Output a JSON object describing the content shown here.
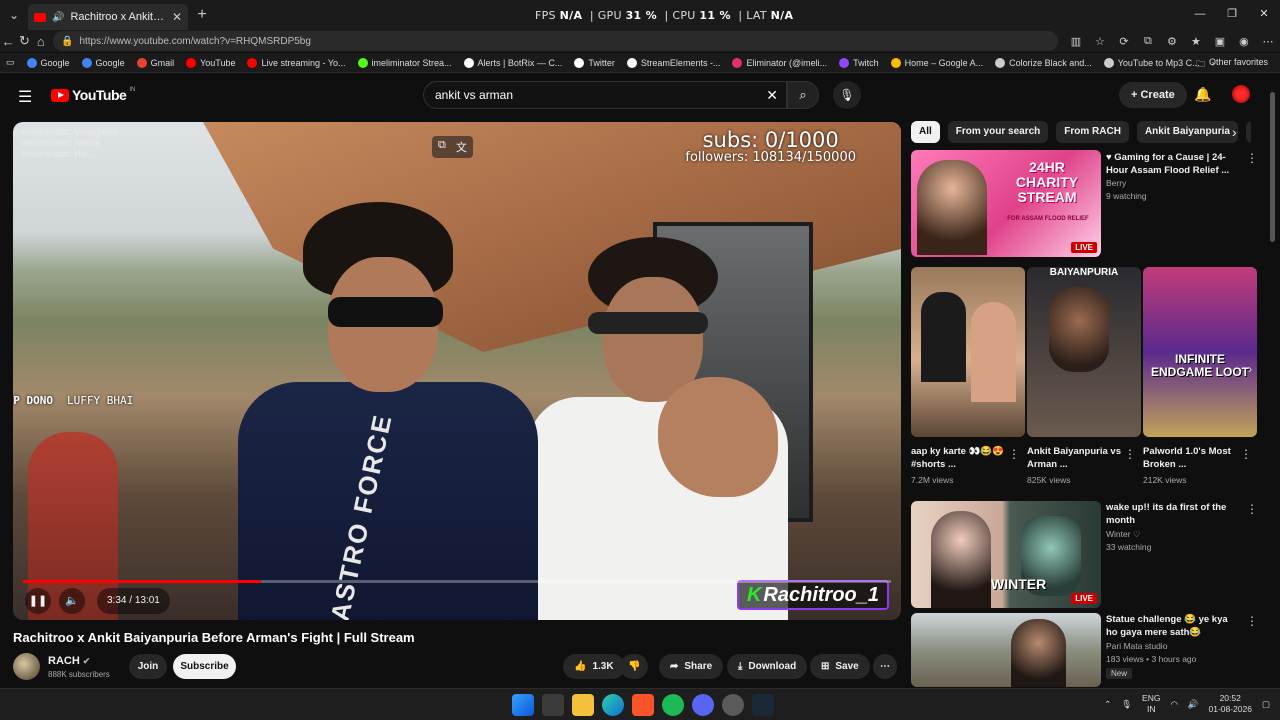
{
  "browser": {
    "tab_title": "Rachitroo x Ankit Baiyanpuria",
    "perf_overlay": {
      "fps_label": "FPS",
      "fps": "N/A",
      "gpu_label": "GPU",
      "gpu": "31 %",
      "cpu_label": "CPU",
      "cpu": "11 %",
      "lat_label": "LAT",
      "lat": "N/A"
    },
    "url": "https://www.youtube.com/watch?v=RHQMSRDP5bg",
    "bookmarks": [
      {
        "label": "Google",
        "color": "#4285f4"
      },
      {
        "label": "Google",
        "color": "#4285f4"
      },
      {
        "label": "Gmail",
        "color": "#ea4335"
      },
      {
        "label": "YouTube",
        "color": "#ff0000"
      },
      {
        "label": "Live streaming - Yo...",
        "color": "#ff0000"
      },
      {
        "label": "imeliminator Strea...",
        "color": "#53fc18"
      },
      {
        "label": "Alerts | BotRix — C...",
        "color": "#ffffff"
      },
      {
        "label": "Twitter",
        "color": "#ffffff"
      },
      {
        "label": "StreamElements -...",
        "color": "#ffffff"
      },
      {
        "label": "Eliminator (@imeli...",
        "color": "#e1306c"
      },
      {
        "label": "Twitch",
        "color": "#9146ff"
      },
      {
        "label": "Home – Google A...",
        "color": "#fbbc04"
      },
      {
        "label": "Colorize Black and...",
        "color": "#cccccc"
      },
      {
        "label": "YouTube to Mp3 C...",
        "color": "#cccccc"
      }
    ],
    "other_favorites": "Other favorites"
  },
  "youtube": {
    "logo_text": "YouTube",
    "logo_region": "IN",
    "search_query": "ankit vs arman",
    "create_label": "Create"
  },
  "video": {
    "stream_overlay": {
      "subs": "subs: 0/1000",
      "followers": "followers: 108134/150000",
      "top_dono": "TOP DONO",
      "top_dono_name": "LUFFY BHAI",
      "ghost_chat": "imeliminator: Vonsgreen\nimeliminator: Nessa\nimeliminator: Hai..."
    },
    "shirt_text": "ASTRO FORCE",
    "watermark": "Rachitroo_1",
    "watermark_k": "K",
    "time_current": "3:34",
    "time_total": "13:01",
    "time_sep": " / ",
    "progress": 0.274,
    "title": "Rachitroo x Ankit Baiyanpuria Before Arman's Fight | Full Stream",
    "channel": {
      "name": "RACH",
      "subscribers": "888K subscribers",
      "join": "Join",
      "subscribe": "Subscribe"
    },
    "actions": {
      "likes": "1.3K",
      "share": "Share",
      "download": "Download",
      "save": "Save"
    }
  },
  "sidebar": {
    "chips": [
      "All",
      "From your search",
      "From RACH",
      "Ankit Baiyanpuria",
      "Re"
    ],
    "videos": [
      {
        "title": "♥ Gaming for a Cause | 24-Hour Assam Flood Relief ...",
        "channel": "Berry",
        "meta": "9 watching",
        "badge": "LIVE",
        "thumb_text": "24HR CHARITY STREAM",
        "thumb_sub": "FOR ASSAM FLOOD RELIEF"
      },
      {
        "title": "wake up!! its da first of the month",
        "channel": "Winter ♡",
        "meta": "33 watching",
        "badge": "LIVE",
        "thumb_text": "WINTER"
      },
      {
        "title": "Statue challenge 😂 ye kya ho gaya mere sath😂",
        "channel": "Pari Mata studio",
        "meta": "183 views • 3 hours ago",
        "badge": "New"
      }
    ],
    "shorts": [
      {
        "title": "aap ky karte 👀😂😍 #shorts ...",
        "views": "7.2M views"
      },
      {
        "title": "Ankit Baiyanpuria vs Arman ...",
        "views": "825K views",
        "thumb_text": "BAIYANPURIA"
      },
      {
        "title": "Palworld 1.0's Most Broken ...",
        "views": "212K views",
        "thumb_text": "INFINITE ENDGAME LOOT"
      }
    ]
  },
  "taskbar": {
    "lang": "ENG",
    "region": "IN",
    "time": "20:52",
    "date": "01-08-2026"
  }
}
